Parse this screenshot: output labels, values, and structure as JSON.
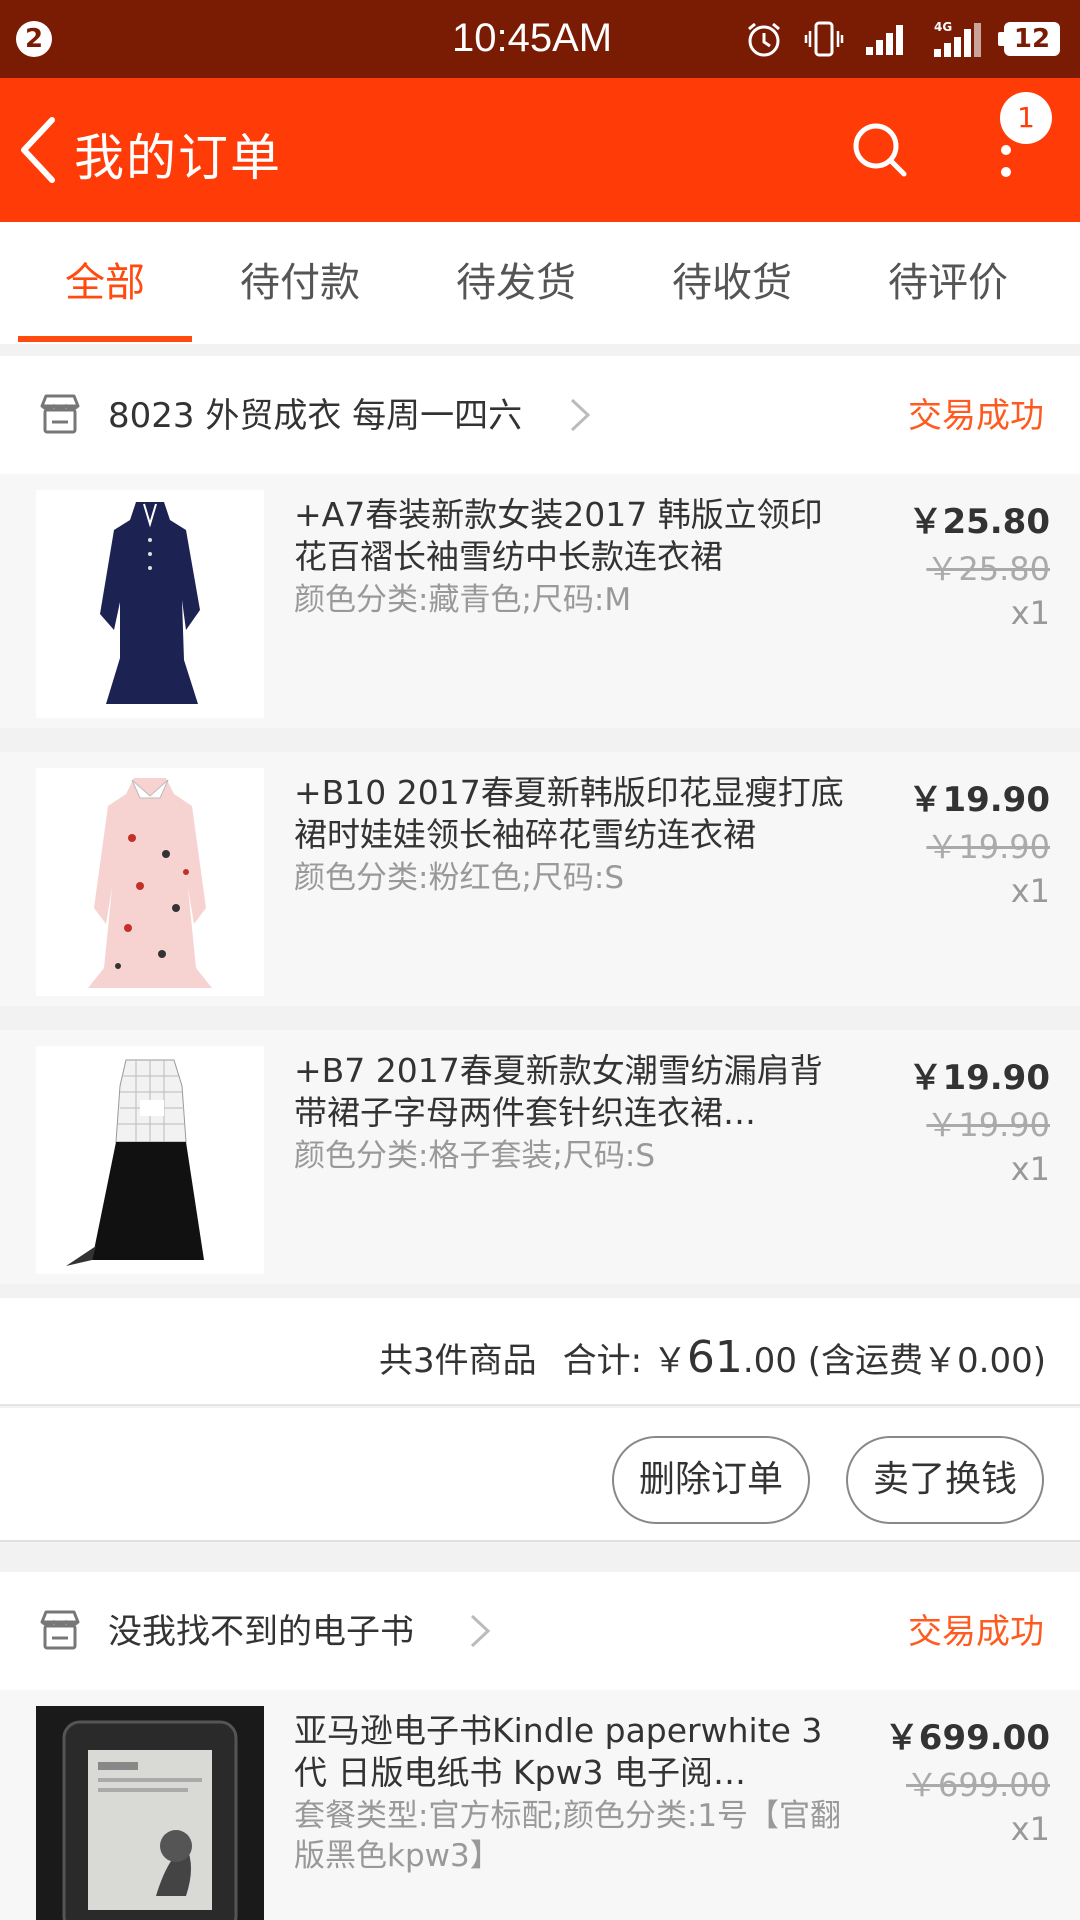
{
  "status_bar": {
    "notification_count": "2",
    "time": "10:45AM",
    "network": "4G",
    "battery": "12"
  },
  "header": {
    "title": "我的订单",
    "more_badge": "1"
  },
  "tabs": [
    {
      "label": "全部",
      "active": true
    },
    {
      "label": "待付款",
      "active": false
    },
    {
      "label": "待发货",
      "active": false
    },
    {
      "label": "待收货",
      "active": false
    },
    {
      "label": "待评价",
      "active": false
    }
  ],
  "orders": [
    {
      "shop": "8023 外贸成衣 每周一四六",
      "status": "交易成功",
      "items": [
        {
          "title": "+A7春装新款女装2017 韩版立领印花百褶长袖雪纺中长款连衣裙",
          "spec": "颜色分类:藏青色;尺码:M",
          "price": "￥25.80",
          "original_price": "￥25.80",
          "qty": "x1"
        },
        {
          "title": "+B10 2017春夏新韩版印花显瘦打底裙时娃娃领长袖碎花雪纺连衣裙",
          "spec": "颜色分类:粉红色;尺码:S",
          "price": "￥19.90",
          "original_price": "￥19.90",
          "qty": "x1"
        },
        {
          "title": "+B7 2017春夏新款女潮雪纺漏肩背带裙子字母两件套针织连衣裙…",
          "spec": "颜色分类:格子套装;尺码:S",
          "price": "￥19.90",
          "original_price": "￥19.90",
          "qty": "x1"
        }
      ],
      "summary": {
        "count_text": "共3件商品",
        "total_prefix": "合计: ￥",
        "total_int": "61",
        "total_dec": ".00",
        "shipping_text": " (含运费￥0.00)"
      },
      "buttons": {
        "delete": "删除订单",
        "resell": "卖了换钱"
      }
    },
    {
      "shop": "没我找不到的电子书",
      "status": "交易成功",
      "items": [
        {
          "title": "亚马逊电子书Kindle paperwhite 3代 日版电纸书 Kpw3 电子阅…",
          "spec": "套餐类型:官方标配;颜色分类:1号【官翻版黑色kpw3】",
          "price": "￥699.00",
          "original_price": "￥699.00",
          "qty": "x1"
        }
      ]
    }
  ]
}
